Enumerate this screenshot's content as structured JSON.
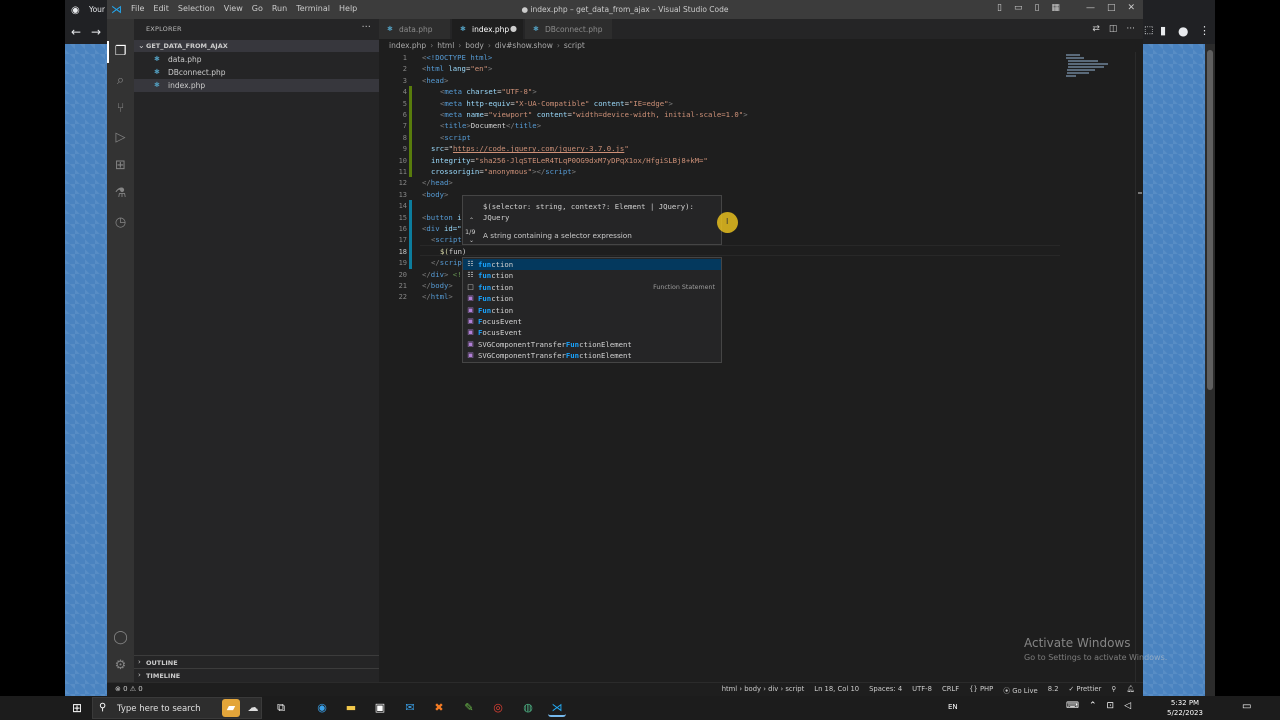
{
  "browser": {
    "tab_title": "Your"
  },
  "window": {
    "title": "● index.php – get_data_from_ajax – Visual Studio Code"
  },
  "menu": [
    "File",
    "Edit",
    "Selection",
    "View",
    "Go",
    "Run",
    "Terminal",
    "Help"
  ],
  "sidebar": {
    "title": "EXPLORER",
    "folder": "GET_DATA_FROM_AJAX",
    "files": [
      {
        "name": "data.php"
      },
      {
        "name": "DBconnect.php"
      },
      {
        "name": "index.php"
      }
    ],
    "outline": "OUTLINE",
    "timeline": "TIMELINE"
  },
  "tabs": [
    {
      "label": "data.php"
    },
    {
      "label": "index.php",
      "dirty": "●"
    },
    {
      "label": "DBconnect.php"
    }
  ],
  "breadcrumb": [
    "index.php",
    "html",
    "body",
    "div#show.show",
    "script"
  ],
  "line_numbers": [
    "1",
    "2",
    "3",
    "4",
    "5",
    "6",
    "7",
    "8",
    "9",
    "10",
    "11",
    "12",
    "13",
    "14",
    "15",
    "16",
    "17",
    "18",
    "19",
    "20",
    "21",
    "22"
  ],
  "code": {
    "l1": "<!DOCTYPE html>",
    "l2a": "<",
    "l2b": "html",
    "l2c": " lang",
    "l2d": "=",
    "l2e": "\"en\"",
    "l2f": ">",
    "l3": "head",
    "l4a": "meta",
    "l4b": " charset",
    "l4c": "\"UTF-8\"",
    "l5a": "meta",
    "l5b": " http-equiv",
    "l5c": "\"X-UA-Compatible\"",
    "l5d": " content",
    "l5e": "\"IE=edge\"",
    "l6a": "meta",
    "l6b": " name",
    "l6c": "\"viewport\"",
    "l6d": " content",
    "l6e": "\"width=device-width, initial-scale=1.0\"",
    "l7a": "title",
    "l7b": "Document",
    "l7c": "title",
    "l8": "script",
    "l9a": "src",
    "l9b": "https://code.jquery.com/jquery-3.7.0.js",
    "l10a": "integrity",
    "l10b": "\"sha256-JlqSTELeR4TLqP0OG9dxM7yDPqX1ox/HfgiSLBj8+kM=\"",
    "l11a": "crossorigin",
    "l11b": "\"anonymous\"",
    "l11c": "script",
    "l12": "head",
    "l13": "body",
    "l15a": "button",
    "l15b": " i",
    "l16a": "div",
    "l16b": " id=\"",
    "l17": "script",
    "l18a": "$(",
    "l18b": "fun",
    "l18c": ")",
    "l19": "scrip",
    "l20a": "div",
    "l20b": "<!--#s",
    "l21": "body",
    "l22": "html"
  },
  "hover": {
    "signature": "$(selector: string, context?: Element | JQuery): JQuery",
    "doc": "A string containing a selector expression",
    "counter": "1/9"
  },
  "suggestions": [
    {
      "pre": "",
      "hl": "fun",
      "post": "ction",
      "icon": "☷",
      "detail": ""
    },
    {
      "pre": "",
      "hl": "fun",
      "post": "ction",
      "icon": "☷",
      "detail": ""
    },
    {
      "pre": "",
      "hl": "fun",
      "post": "ction",
      "icon": "□",
      "detail": "Function Statement"
    },
    {
      "pre": "",
      "hl": "Fun",
      "post": "ction",
      "icon": "▣",
      "detail": ""
    },
    {
      "pre": "",
      "hl": "Fun",
      "post": "ction",
      "icon": "▣",
      "detail": ""
    },
    {
      "pre": "",
      "hl": "F",
      "post": "ocusEvent",
      "icon": "▣",
      "detail": ""
    },
    {
      "pre": "",
      "hl": "F",
      "post": "ocusEvent",
      "icon": "▣",
      "detail": ""
    },
    {
      "pre": "SVGComponentTransfer",
      "hl": "Fun",
      "post": "ctionElement",
      "icon": "▣",
      "detail": ""
    },
    {
      "pre": "SVGComponentTransfer",
      "hl": "Fun",
      "post": "ctionElement",
      "icon": "▣",
      "detail": ""
    }
  ],
  "activate": {
    "heading": "Activate Windows",
    "sub": "Go to Settings to activate Windows."
  },
  "status": {
    "left": "⊗ 0 ⚠ 0",
    "right": [
      "html › body › div › script",
      "Ln 18, Col 10",
      "Spaces: 4",
      "UTF-8",
      "CRLF",
      "{} PHP",
      "⦿ Go Live",
      "8.2",
      "✓ Prettier"
    ]
  },
  "taskbar": {
    "search_placeholder": "Type here to search",
    "language": "EN",
    "time": "5:32 PM",
    "date": "5/22/2023"
  },
  "colors": {
    "accent": "#007acc",
    "selection": "#04395e",
    "highlight": "#18a3ff"
  }
}
